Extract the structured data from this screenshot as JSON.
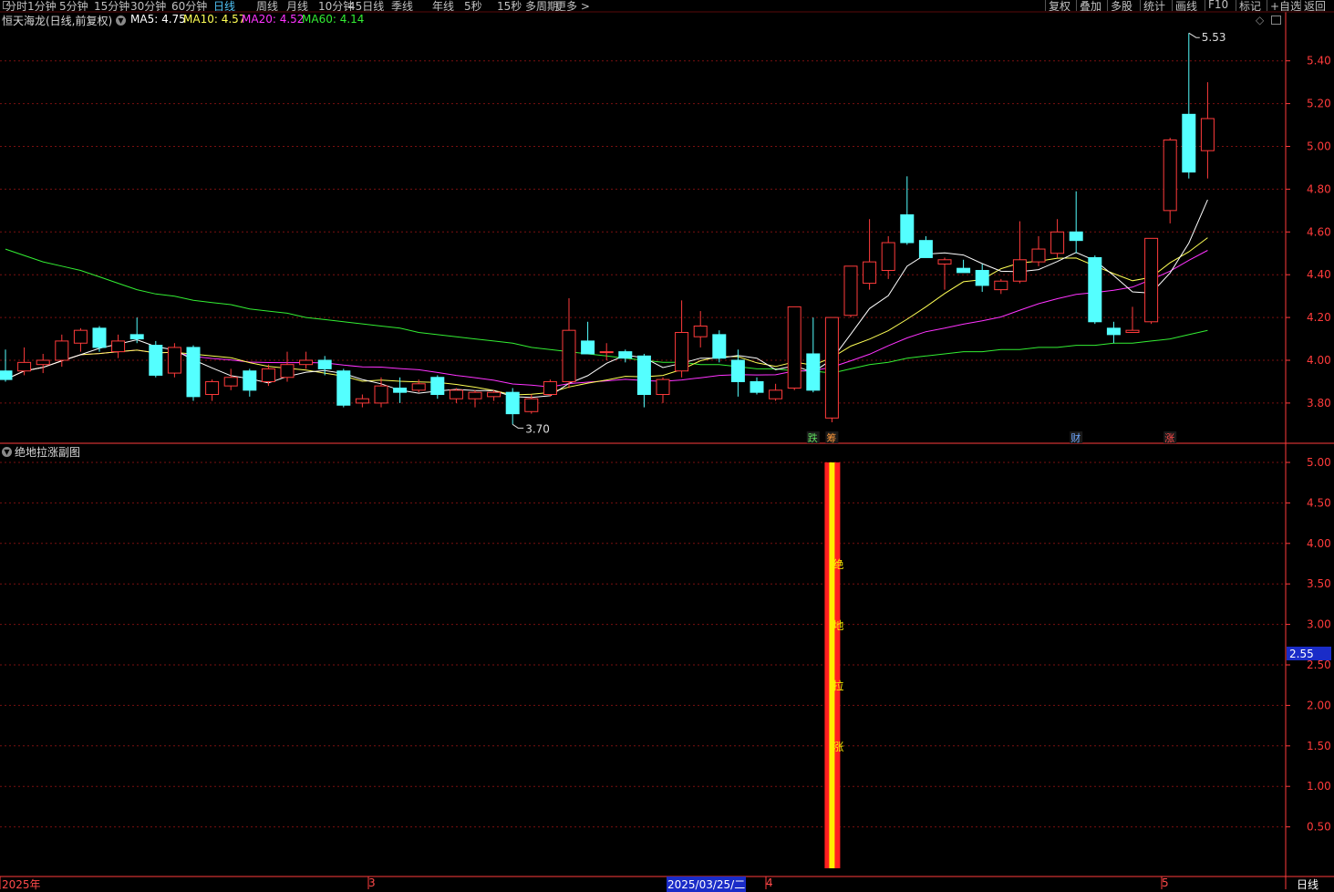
{
  "toolbar": {
    "periods": [
      "分时",
      "1分钟",
      "5分钟",
      "15分钟",
      "30分钟",
      "60分钟",
      "日线",
      "周线",
      "月线",
      "10分钟",
      "45日线",
      "季线",
      "年线",
      "5秒",
      "15秒",
      "多周期",
      "更多 >"
    ],
    "active_period": "日线",
    "right_buttons": [
      "复权",
      "叠加",
      "多股",
      "统计",
      "画线",
      "F10",
      "标记",
      "+自选",
      "返回"
    ]
  },
  "main_info": {
    "title": "恒天海龙(日线,前复权)",
    "ma5_label": "MA5:",
    "ma5_value": "4.75",
    "ma10_label": "MA10:",
    "ma10_value": "4.57",
    "ma20_label": "MA20:",
    "ma20_value": "4.52",
    "ma60_label": "MA60:",
    "ma60_value": "4.14"
  },
  "sub_info": {
    "title": "绝地拉涨副图"
  },
  "colors": {
    "up": "#ff3b3b",
    "down": "#54ffff",
    "ma5": "#ffffff",
    "ma10": "#ffff55",
    "ma20": "#ff33ff",
    "ma60": "#33ee33",
    "grid": "#7a1010",
    "axis": "#ff3b3b"
  },
  "markers": [
    {
      "text": "跌",
      "color": "#5fdc5f"
    },
    {
      "text": "筹",
      "color": "#ff9a3c"
    },
    {
      "text": "财",
      "color": "#6fa8ff"
    },
    {
      "text": "涨",
      "color": "#ff4a4a"
    }
  ],
  "price_annotations": {
    "high": "5.53",
    "low": "3.70"
  },
  "cursor_value": "2.55",
  "signal_label": [
    "绝",
    "地",
    "拉",
    "涨"
  ],
  "bottom": {
    "year_label": "2025年",
    "month3": "3",
    "selected_date": "2025/03/25/二",
    "month4": "4",
    "month5": "5",
    "period_label": "日线"
  },
  "chart_data": [
    {
      "type": "candlestick",
      "title": "恒天海龙(日线,前复权)",
      "y_ticks": [
        5.4,
        5.2,
        5.0,
        4.8,
        4.6,
        4.4,
        4.2,
        4.0,
        3.8
      ],
      "ylim": [
        3.64,
        5.56
      ],
      "candles": [
        {
          "o": 3.95,
          "h": 4.05,
          "l": 3.9,
          "c": 3.91
        },
        {
          "o": 3.95,
          "h": 4.06,
          "l": 3.93,
          "c": 3.99
        },
        {
          "o": 3.98,
          "h": 4.03,
          "l": 3.94,
          "c": 4.0
        },
        {
          "o": 4.0,
          "h": 4.12,
          "l": 3.97,
          "c": 4.09
        },
        {
          "o": 4.08,
          "h": 4.15,
          "l": 4.04,
          "c": 4.14
        },
        {
          "o": 4.15,
          "h": 4.16,
          "l": 4.04,
          "c": 4.06
        },
        {
          "o": 4.04,
          "h": 4.12,
          "l": 4.01,
          "c": 4.09
        },
        {
          "o": 4.12,
          "h": 4.2,
          "l": 4.08,
          "c": 4.1
        },
        {
          "o": 4.07,
          "h": 4.09,
          "l": 3.92,
          "c": 3.93
        },
        {
          "o": 3.94,
          "h": 4.08,
          "l": 3.92,
          "c": 4.06
        },
        {
          "o": 4.06,
          "h": 4.07,
          "l": 3.81,
          "c": 3.83
        },
        {
          "o": 3.84,
          "h": 3.91,
          "l": 3.81,
          "c": 3.9
        },
        {
          "o": 3.88,
          "h": 3.96,
          "l": 3.86,
          "c": 3.92
        },
        {
          "o": 3.95,
          "h": 3.96,
          "l": 3.83,
          "c": 3.86
        },
        {
          "o": 3.9,
          "h": 3.98,
          "l": 3.88,
          "c": 3.96
        },
        {
          "o": 3.92,
          "h": 4.04,
          "l": 3.9,
          "c": 3.98
        },
        {
          "o": 3.98,
          "h": 4.04,
          "l": 3.96,
          "c": 4.0
        },
        {
          "o": 4.0,
          "h": 4.02,
          "l": 3.93,
          "c": 3.96
        },
        {
          "o": 3.95,
          "h": 3.96,
          "l": 3.78,
          "c": 3.79
        },
        {
          "o": 3.8,
          "h": 3.84,
          "l": 3.78,
          "c": 3.82
        },
        {
          "o": 3.8,
          "h": 3.92,
          "l": 3.78,
          "c": 3.88
        },
        {
          "o": 3.87,
          "h": 3.92,
          "l": 3.8,
          "c": 3.85
        },
        {
          "o": 3.86,
          "h": 3.91,
          "l": 3.85,
          "c": 3.89
        },
        {
          "o": 3.92,
          "h": 3.93,
          "l": 3.82,
          "c": 3.84
        },
        {
          "o": 3.82,
          "h": 3.87,
          "l": 3.8,
          "c": 3.86
        },
        {
          "o": 3.82,
          "h": 3.86,
          "l": 3.78,
          "c": 3.85
        },
        {
          "o": 3.83,
          "h": 3.86,
          "l": 3.81,
          "c": 3.85
        },
        {
          "o": 3.85,
          "h": 3.87,
          "l": 3.7,
          "c": 3.75
        },
        {
          "o": 3.76,
          "h": 3.84,
          "l": 3.75,
          "c": 3.82
        },
        {
          "o": 3.84,
          "h": 3.91,
          "l": 3.83,
          "c": 3.9
        },
        {
          "o": 3.9,
          "h": 4.29,
          "l": 3.87,
          "c": 4.14
        },
        {
          "o": 4.09,
          "h": 4.18,
          "l": 4.05,
          "c": 4.03
        },
        {
          "o": 4.04,
          "h": 4.08,
          "l": 4.0,
          "c": 4.04
        },
        {
          "o": 4.04,
          "h": 4.05,
          "l": 3.99,
          "c": 4.01
        },
        {
          "o": 4.02,
          "h": 4.03,
          "l": 3.78,
          "c": 3.84
        },
        {
          "o": 3.84,
          "h": 3.92,
          "l": 3.8,
          "c": 3.91
        },
        {
          "o": 3.95,
          "h": 4.28,
          "l": 3.92,
          "c": 4.13
        },
        {
          "o": 4.11,
          "h": 4.23,
          "l": 4.06,
          "c": 4.16
        },
        {
          "o": 4.12,
          "h": 4.14,
          "l": 3.99,
          "c": 4.01
        },
        {
          "o": 4.0,
          "h": 4.05,
          "l": 3.83,
          "c": 3.9
        },
        {
          "o": 3.9,
          "h": 3.92,
          "l": 3.84,
          "c": 3.85
        },
        {
          "o": 3.82,
          "h": 3.89,
          "l": 3.81,
          "c": 3.86
        },
        {
          "o": 3.87,
          "h": 4.25,
          "l": 3.86,
          "c": 4.25
        },
        {
          "o": 4.03,
          "h": 4.2,
          "l": 3.85,
          "c": 3.86
        },
        {
          "o": 3.73,
          "h": 4.2,
          "l": 3.71,
          "c": 4.2
        },
        {
          "o": 4.21,
          "h": 4.44,
          "l": 4.2,
          "c": 4.44
        },
        {
          "o": 4.36,
          "h": 4.66,
          "l": 4.33,
          "c": 4.46
        },
        {
          "o": 4.42,
          "h": 4.58,
          "l": 4.38,
          "c": 4.55
        },
        {
          "o": 4.68,
          "h": 4.86,
          "l": 4.54,
          "c": 4.55
        },
        {
          "o": 4.56,
          "h": 4.58,
          "l": 4.48,
          "c": 4.48
        },
        {
          "o": 4.45,
          "h": 4.48,
          "l": 4.33,
          "c": 4.47
        },
        {
          "o": 4.43,
          "h": 4.47,
          "l": 4.41,
          "c": 4.41
        },
        {
          "o": 4.42,
          "h": 4.45,
          "l": 4.32,
          "c": 4.35
        },
        {
          "o": 4.33,
          "h": 4.38,
          "l": 4.31,
          "c": 4.37
        },
        {
          "o": 4.37,
          "h": 4.65,
          "l": 4.36,
          "c": 4.47
        },
        {
          "o": 4.46,
          "h": 4.58,
          "l": 4.44,
          "c": 4.52
        },
        {
          "o": 4.5,
          "h": 4.66,
          "l": 4.48,
          "c": 4.6
        },
        {
          "o": 4.6,
          "h": 4.79,
          "l": 4.5,
          "c": 4.56
        },
        {
          "o": 4.48,
          "h": 4.49,
          "l": 4.17,
          "c": 4.18
        },
        {
          "o": 4.15,
          "h": 4.18,
          "l": 4.08,
          "c": 4.12
        },
        {
          "o": 4.13,
          "h": 4.25,
          "l": 4.13,
          "c": 4.14
        },
        {
          "o": 4.18,
          "h": 4.57,
          "l": 4.17,
          "c": 4.57
        },
        {
          "o": 4.7,
          "h": 5.04,
          "l": 4.64,
          "c": 5.03
        },
        {
          "o": 5.15,
          "h": 5.53,
          "l": 4.85,
          "c": 4.88
        },
        {
          "o": 4.98,
          "h": 5.3,
          "l": 4.85,
          "c": 5.13
        }
      ],
      "ma60_series": [
        4.52,
        4.49,
        4.46,
        4.44,
        4.42,
        4.39,
        4.36,
        4.33,
        4.31,
        4.3,
        4.28,
        4.27,
        4.26,
        4.24,
        4.23,
        4.22,
        4.2,
        4.19,
        4.18,
        4.17,
        4.16,
        4.15,
        4.13,
        4.12,
        4.11,
        4.1,
        4.09,
        4.08,
        4.06,
        4.05,
        4.04,
        4.03,
        4.02,
        4.01,
        4.0,
        3.99,
        3.99,
        3.98,
        3.98,
        3.97,
        3.96,
        3.96,
        3.95,
        3.95,
        3.94,
        3.96,
        3.98,
        3.99,
        4.01,
        4.02,
        4.03,
        4.04,
        4.04,
        4.05,
        4.05,
        4.06,
        4.06,
        4.07,
        4.07,
        4.08,
        4.08,
        4.09,
        4.1,
        4.12,
        4.14
      ]
    },
    {
      "type": "bar",
      "title": "绝地拉涨副图",
      "y_ticks": [
        5.0,
        4.5,
        4.0,
        3.5,
        3.0,
        2.5,
        2.0,
        1.5,
        1.0,
        0.5
      ],
      "ylim": [
        0,
        5.0
      ],
      "signal_index": 44,
      "signal_value": 5.0
    }
  ]
}
